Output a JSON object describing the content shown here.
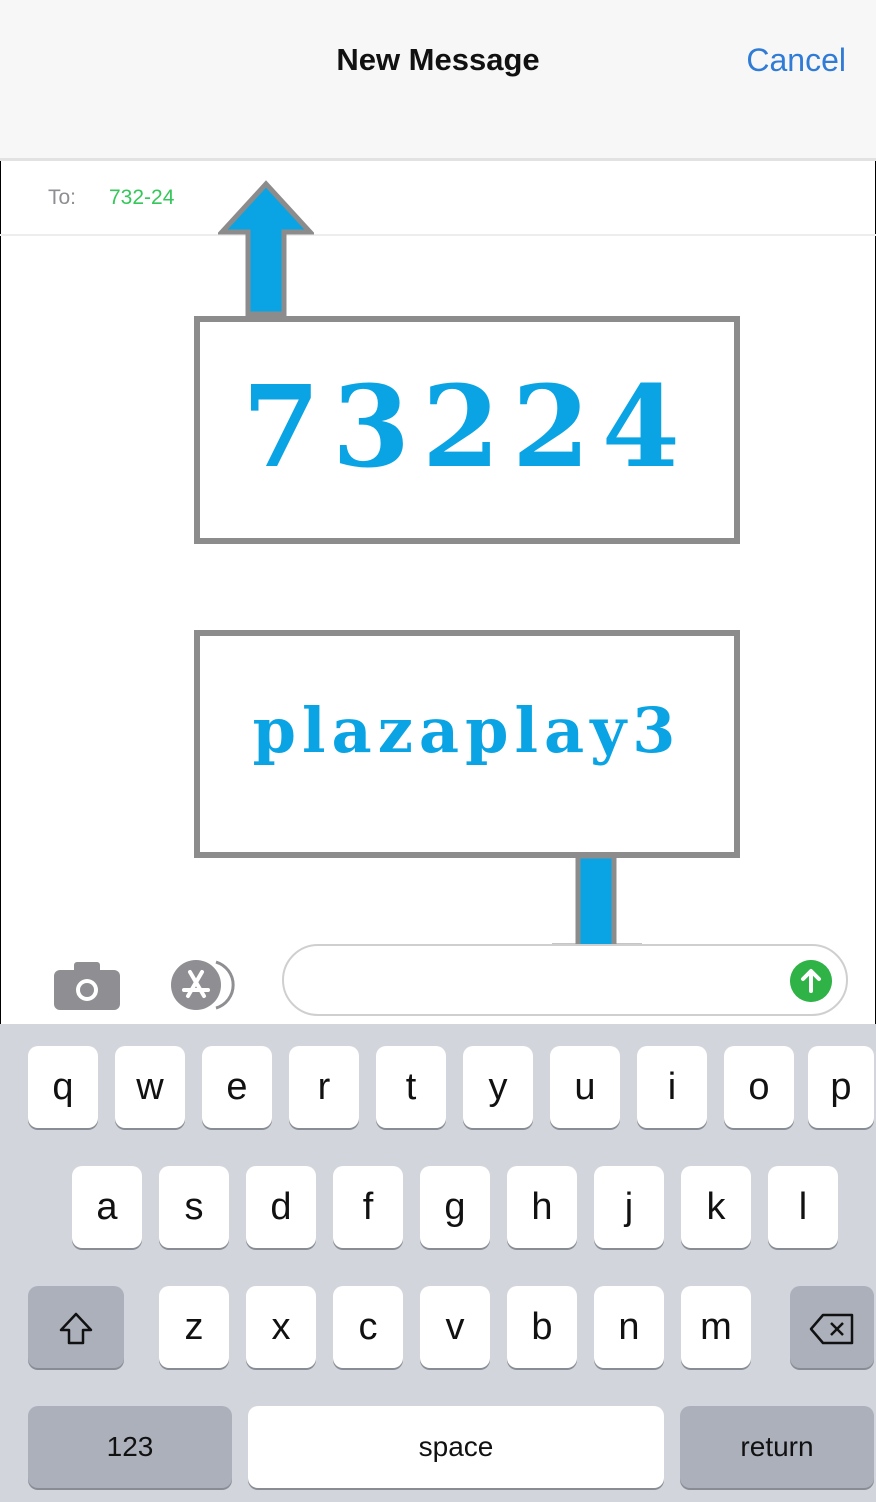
{
  "nav": {
    "title": "New Message",
    "cancel": "Cancel"
  },
  "recipient": {
    "label": "To:",
    "value": "732-24"
  },
  "callouts": {
    "number": "73224",
    "keyword": "plazaplay3"
  },
  "icons": {
    "camera": "camera-icon",
    "appstore": "app-store-icon",
    "send": "send-arrow-icon",
    "shift": "shift-icon",
    "delete": "backspace-icon"
  },
  "colors": {
    "accent": "#0aa4e4",
    "send": "#2fb347",
    "recipient": "#34c759",
    "link": "#2f7bd6"
  },
  "keyboard": {
    "row1": [
      "q",
      "w",
      "e",
      "r",
      "t",
      "y",
      "u",
      "i",
      "o",
      "p"
    ],
    "row2": [
      "a",
      "s",
      "d",
      "f",
      "g",
      "h",
      "j",
      "k",
      "l"
    ],
    "row3": [
      "z",
      "x",
      "c",
      "v",
      "b",
      "n",
      "m"
    ],
    "numbers": "123",
    "space": "space",
    "return": "return"
  }
}
